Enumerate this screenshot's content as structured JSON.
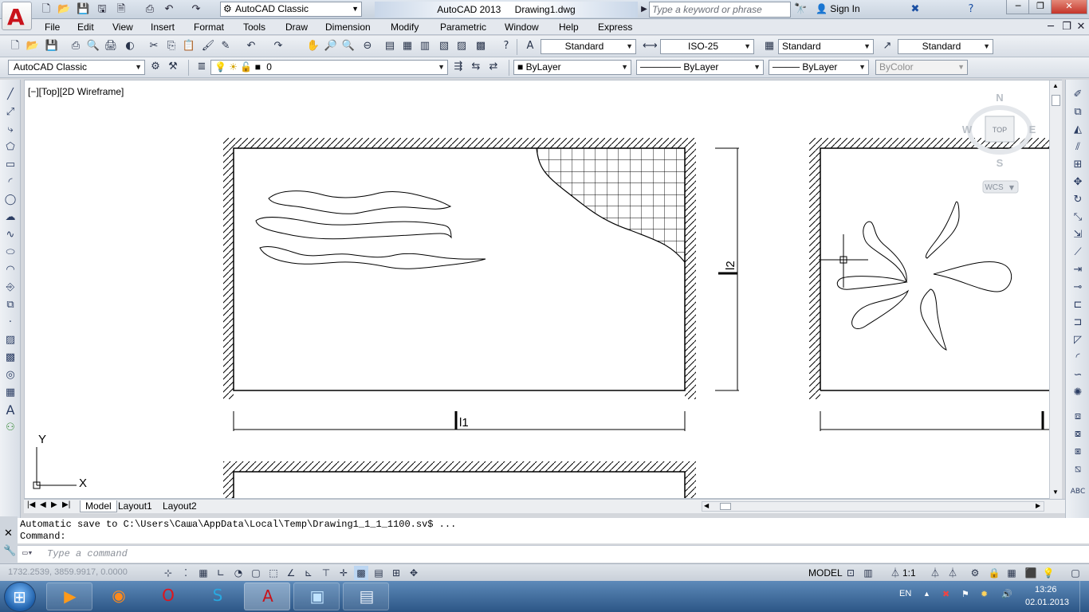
{
  "window": {
    "workspace": "AutoCAD Classic",
    "app_title": "AutoCAD 2013",
    "file_title": "Drawing1.dwg",
    "search_placeholder": "Type a keyword or phrase",
    "sign_in": "Sign In"
  },
  "menu": [
    "File",
    "Edit",
    "View",
    "Insert",
    "Format",
    "Tools",
    "Draw",
    "Dimension",
    "Modify",
    "Parametric",
    "Window",
    "Help",
    "Express"
  ],
  "styles": {
    "text_style": "Standard",
    "dim_style": "ISO-25",
    "table_style": "Standard",
    "mleader_style": "Standard"
  },
  "layers": {
    "workspace": "AutoCAD Classic",
    "layer_name": "0",
    "color": "ByLayer",
    "linetype": "ByLayer",
    "lineweight": "ByLayer",
    "plotstyle": "ByColor"
  },
  "viewport": {
    "label": "[−][Top][2D Wireframe]",
    "viewcube_top": "TOP",
    "compass_n": "N",
    "compass_s": "S",
    "compass_e": "E",
    "compass_w": "W",
    "wcs": "WCS",
    "ucs_x": "X",
    "ucs_y": "Y",
    "dim_l1": "l1",
    "dim_l2": "l2"
  },
  "tabs": [
    "Model",
    "Layout1",
    "Layout2"
  ],
  "command": {
    "history_line1": "Automatic save to C:\\Users\\Саша\\AppData\\Local\\Temp\\Drawing1_1_1_1100.sv$ ...",
    "history_line2": "Command:",
    "placeholder": "Type a command"
  },
  "status": {
    "coords": "1732.2539, 3859.9917, 0.0000",
    "model": "MODEL",
    "scale": "1:1"
  },
  "taskbar": {
    "lang": "EN",
    "time": "13:26",
    "date": "02.01.2013"
  },
  "colors": {
    "accent_red": "#c9121a",
    "taskbar": "#2c5686"
  }
}
